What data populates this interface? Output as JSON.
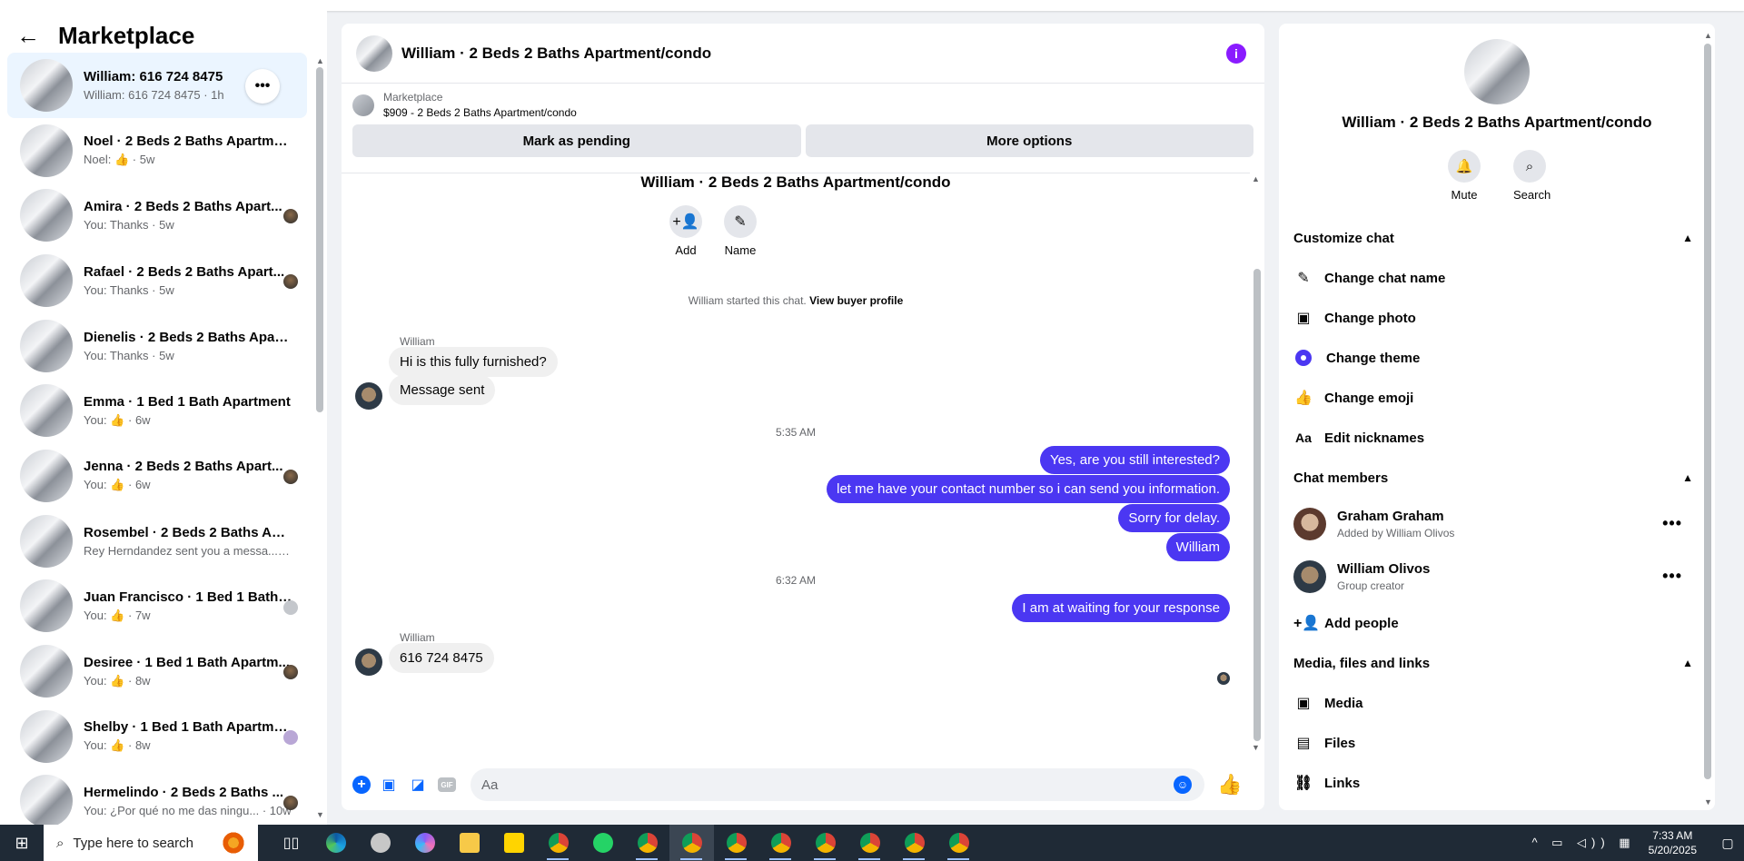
{
  "sidebar": {
    "back_icon": "back-arrow-icon",
    "title": "Marketplace",
    "conversations": [
      {
        "name": "William: 616 724 8475",
        "sub": "William: 616 724 8475 · 1h",
        "active": true
      },
      {
        "name": "Noel · 2 Beds 2 Baths Apartment",
        "sub_prefix": "Noel:",
        "sub_suffix": "· 5w",
        "like": true
      },
      {
        "name": "Amira · 2 Beds 2 Baths Apart...",
        "sub": "You: Thanks · 5w"
      },
      {
        "name": "Rafael · 2 Beds 2 Baths Apart...",
        "sub": "You: Thanks · 5w"
      },
      {
        "name": "Dienelis · 2 Beds 2 Baths Apartm...",
        "sub": "You: Thanks · 5w"
      },
      {
        "name": "Emma · 1 Bed 1 Bath Apartment",
        "sub_prefix": "You:",
        "sub_suffix": "· 6w",
        "like": true
      },
      {
        "name": "Jenna · 2 Beds 2 Baths Apart...",
        "sub_prefix": "You:",
        "sub_suffix": "· 6w",
        "like": true
      },
      {
        "name": "Rosembel · 2 Beds 2 Baths Apart...",
        "sub": "Rey Herndandez sent you a messa... · 7w"
      },
      {
        "name": "Juan Francisco · 1 Bed 1 Bath ...",
        "sub_prefix": "You:",
        "sub_suffix": "· 7w",
        "like": true
      },
      {
        "name": "Desiree · 1 Bed 1 Bath Apartm...",
        "sub_prefix": "You:",
        "sub_suffix": "· 8w",
        "like": true
      },
      {
        "name": "Shelby · 1 Bed 1 Bath Apartment",
        "sub_prefix": "You:",
        "sub_suffix": "· 8w",
        "like": true
      },
      {
        "name": "Hermelindo · 2 Beds 2 Baths ...",
        "sub": "You: ¿Por qué no me das ningu... · 10w"
      }
    ]
  },
  "chat": {
    "title": "William · 2 Beds 2 Baths Apartment/condo",
    "marketplace_label": "Marketplace",
    "listing": "$909 - 2 Beds 2 Baths Apartment/condo",
    "mark_pending": "Mark as pending",
    "more_options": "More options",
    "top_title": "William · 2 Beds 2 Baths Apartment/condo",
    "add_label": "Add",
    "name_label": "Name",
    "started_text": "William started this chat.",
    "view_profile": "View buyer profile",
    "sender1": "William",
    "msg1": "Hi is this fully furnished?",
    "msg2": "Message sent",
    "time1": "5:35 AM",
    "out1": "Yes, are you still interested?",
    "out2": "let me have your contact number so i can send you information.",
    "out3": "Sorry for delay.",
    "out4": "William",
    "time2": "6:32 AM",
    "out5": "I am at waiting for your response",
    "sender2": "William",
    "msg3": "616 724 8475",
    "composer_placeholder": "Aa",
    "gif_label": "GIF"
  },
  "right": {
    "title": "William · 2 Beds 2 Baths Apartment/condo",
    "mute": "Mute",
    "search": "Search",
    "customize": "Customize chat",
    "change_name": "Change chat name",
    "change_photo": "Change photo",
    "change_theme": "Change theme",
    "change_emoji": "Change emoji",
    "edit_nicknames": "Edit nicknames",
    "chat_members": "Chat members",
    "member1_name": "Graham Graham",
    "member1_sub": "Added by William Olivos",
    "member2_name": "William Olivos",
    "member2_sub": "Group creator",
    "add_people": "Add people",
    "media_section": "Media, files and links",
    "media": "Media",
    "files": "Files",
    "links": "Links",
    "theme_color": "#4b37f2"
  },
  "taskbar": {
    "search_placeholder": "Type here to search",
    "time": "7:33 AM",
    "date": "5/20/2025"
  }
}
